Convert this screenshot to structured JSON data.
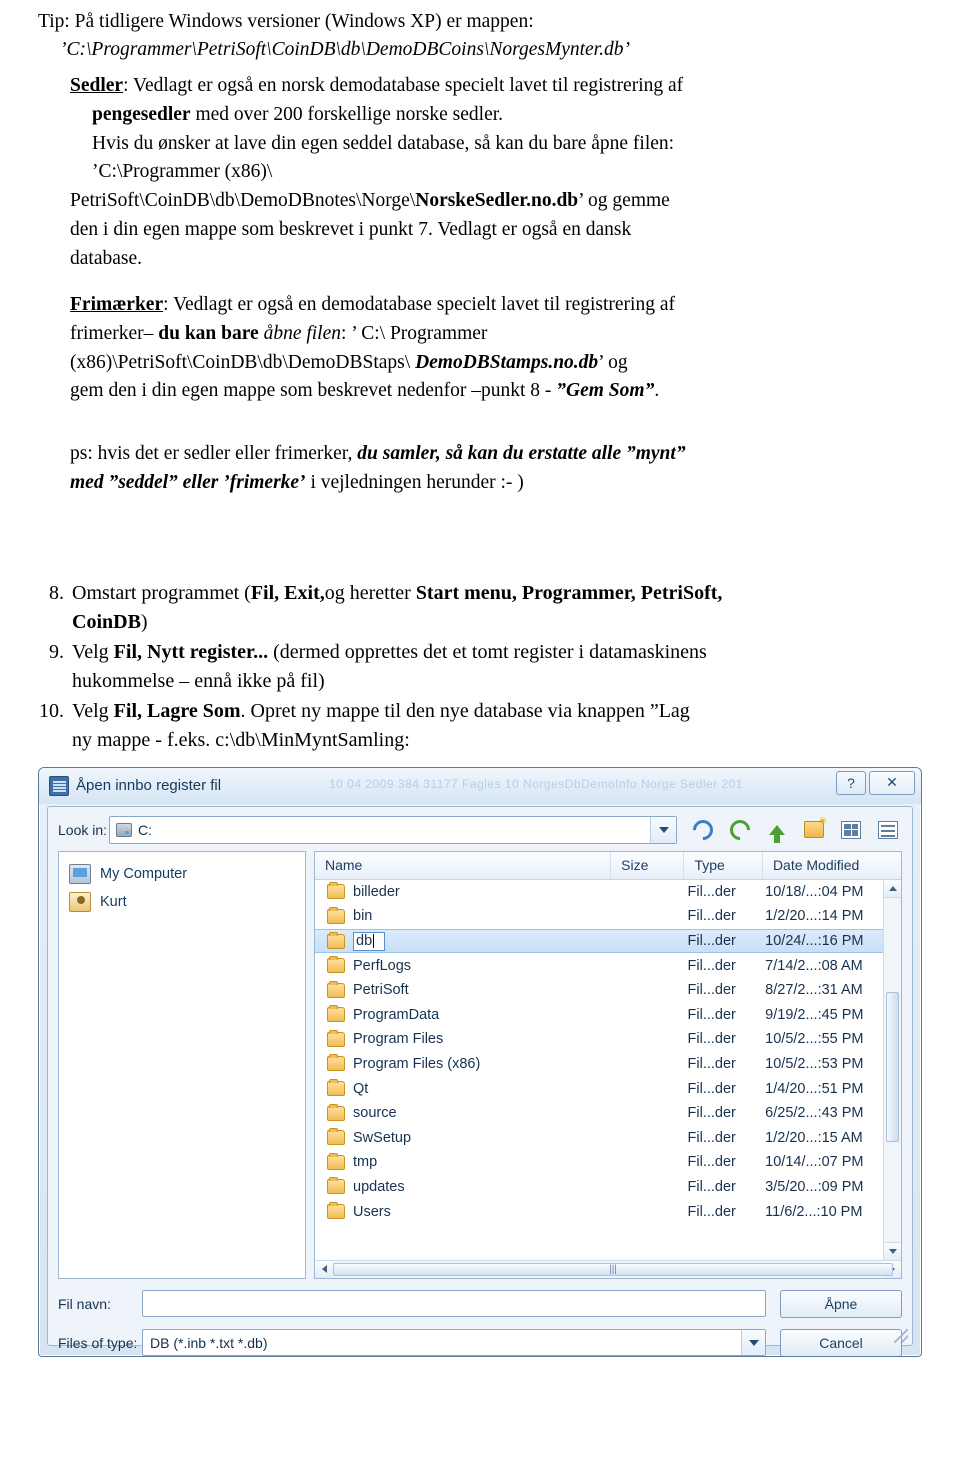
{
  "doc": {
    "tip": {
      "line1": "Tip: På tidligere Windows versioner (Windows XP) er mappen:",
      "line2_italic": "’C:\\Programmer\\PetriSoft\\CoinDB\\db\\DemoDBCoins\\NorgesMynter.db’"
    },
    "sedler": {
      "heading": "Sedler",
      "line1_rest": ": Vedlagt er også en norsk demodatabase specielt lavet til registrering af",
      "line2_bold": "pengesedler",
      "line2_rest": " med over 200 forskellige norske sedler.",
      "line3": "Hvis du ønsker at lave din egen seddel database, så kan du bare åpne filen:",
      "path_part1": "’C:\\Programmer (x86)\\",
      "path_part2": "PetriSoft\\CoinDB\\db\\DemoDBnotes\\Norge\\",
      "path_bold": "NorskeSedler.no.db",
      "path_tail": "’ og gemme",
      "line5": "den i din egen mappe som beskrevet  i punkt 7. Vedlagt er også en dansk",
      "line6": "database."
    },
    "frimaerker": {
      "heading": "Frimærker",
      "line1_rest": ": Vedlagt er også en demodatabase specielt lavet til registrering af",
      "line2_a": "frimerker– ",
      "line2_bold": "du kan bare",
      "line2_b": " åbne filen",
      "line2_c": ": ’ C:\\ Programmer",
      "line3_a": "(x86)\\PetriSoft\\CoinDB\\db\\DemoDBStaps\\ ",
      "line3_bold": "DemoDBStamps.no.db",
      "line3_tail": "’ og",
      "line4_a": "gem den i din egen mappe som beskrevet nedenfor –punkt 8 - ",
      "line4_italic": "”Gem Som”",
      "line4_tail": "."
    },
    "ps": {
      "part1": "ps: hvis det er sedler eller frimerker,",
      "part2": " du samler, så kan du erstatte alle ”mynt”",
      "part3": "med ”seddel” eller ’frimerke’",
      "part4": " i vejledningen herunder :- )"
    },
    "steps": [
      {
        "num": "8.",
        "segments": [
          {
            "t": "Omstart programmet (",
            "s": "normal"
          },
          {
            "t": "Fil, Exit,",
            "s": "bold"
          },
          {
            "t": "og heretter ",
            "s": "normal"
          },
          {
            "t": "Start menu, Programmer, PetriSoft,",
            "s": "bold"
          }
        ],
        "line2_bold": "CoinDB",
        "line2_tail": ")"
      },
      {
        "num": "9.",
        "segments": [
          {
            "t": "Velg ",
            "s": "normal"
          },
          {
            "t": "Fil, Nytt register...",
            "s": "bold"
          },
          {
            "t": "  (dermed opprettes det et tomt register i datamaskinens",
            "s": "normal"
          }
        ],
        "line2": "hukommelse – ennå ikke på fil)"
      },
      {
        "num": "10.",
        "segments": [
          {
            "t": "Velg ",
            "s": "normal"
          },
          {
            "t": "Fil, Lagre Som",
            "s": "bold"
          },
          {
            "t": ". Opret ny mappe til den nye database via knappen ”Lag",
            "s": "normal"
          }
        ],
        "line2": "ny mappe - f.eks.  c:\\db\\MinMyntSamling:"
      }
    ]
  },
  "dialog": {
    "title": "Åpen innbo register fil",
    "ghost_text": "10 04 2009   384 31177 Fagles 10   NorgesDbDemoInfo      Norge Sedler  201",
    "help_btn": "?",
    "close_btn": "✕",
    "lookin_label": "Look in:",
    "lookin_value": "C:",
    "toolbar": [
      "back-icon",
      "forward-icon",
      "up-icon",
      "new-folder-icon",
      "view-grid-icon",
      "view-list-icon"
    ],
    "places": [
      {
        "label": "My Computer",
        "icon": "computer-icon"
      },
      {
        "label": "Kurt",
        "icon": "user-folder-icon"
      }
    ],
    "columns": [
      "Name",
      "Size",
      "Type",
      "Date Modified"
    ],
    "rows": [
      {
        "name": "billeder",
        "size": "",
        "type": "Fil...der",
        "date": "10/18/...:04 PM",
        "selected": false,
        "editing": false
      },
      {
        "name": "bin",
        "size": "",
        "type": "Fil...der",
        "date": "1/2/20...:14 PM",
        "selected": false,
        "editing": false
      },
      {
        "name": "db",
        "size": "",
        "type": "Fil...der",
        "date": "10/24/...:16 PM",
        "selected": true,
        "editing": true
      },
      {
        "name": "PerfLogs",
        "size": "",
        "type": "Fil...der",
        "date": "7/14/2...:08 AM",
        "selected": false,
        "editing": false
      },
      {
        "name": "PetriSoft",
        "size": "",
        "type": "Fil...der",
        "date": "8/27/2...:31 AM",
        "selected": false,
        "editing": false
      },
      {
        "name": "ProgramData",
        "size": "",
        "type": "Fil...der",
        "date": "9/19/2...:45 PM",
        "selected": false,
        "editing": false
      },
      {
        "name": "Program Files",
        "size": "",
        "type": "Fil...der",
        "date": "10/5/2...:55 PM",
        "selected": false,
        "editing": false
      },
      {
        "name": "Program Files (x86)",
        "size": "",
        "type": "Fil...der",
        "date": "10/5/2...:53 PM",
        "selected": false,
        "editing": false
      },
      {
        "name": "Qt",
        "size": "",
        "type": "Fil...der",
        "date": "1/4/20...:51 PM",
        "selected": false,
        "editing": false
      },
      {
        "name": "source",
        "size": "",
        "type": "Fil...der",
        "date": "6/25/2...:43 PM",
        "selected": false,
        "editing": false
      },
      {
        "name": "SwSetup",
        "size": "",
        "type": "Fil...der",
        "date": "1/2/20...:15 AM",
        "selected": false,
        "editing": false
      },
      {
        "name": "tmp",
        "size": "",
        "type": "Fil...der",
        "date": "10/14/...:07 PM",
        "selected": false,
        "editing": false
      },
      {
        "name": "updates",
        "size": "",
        "type": "Fil...der",
        "date": "3/5/20...:09 PM",
        "selected": false,
        "editing": false
      },
      {
        "name": "Users",
        "size": "",
        "type": "Fil...der",
        "date": "11/6/2...:10 PM",
        "selected": false,
        "editing": false
      }
    ],
    "filename_label": "Fil navn:",
    "filename_value": "",
    "filetype_label": "Files of type:",
    "filetype_value": "DB (*.inb *.txt *.db)",
    "open_button": "Åpne",
    "cancel_button": "Cancel"
  }
}
